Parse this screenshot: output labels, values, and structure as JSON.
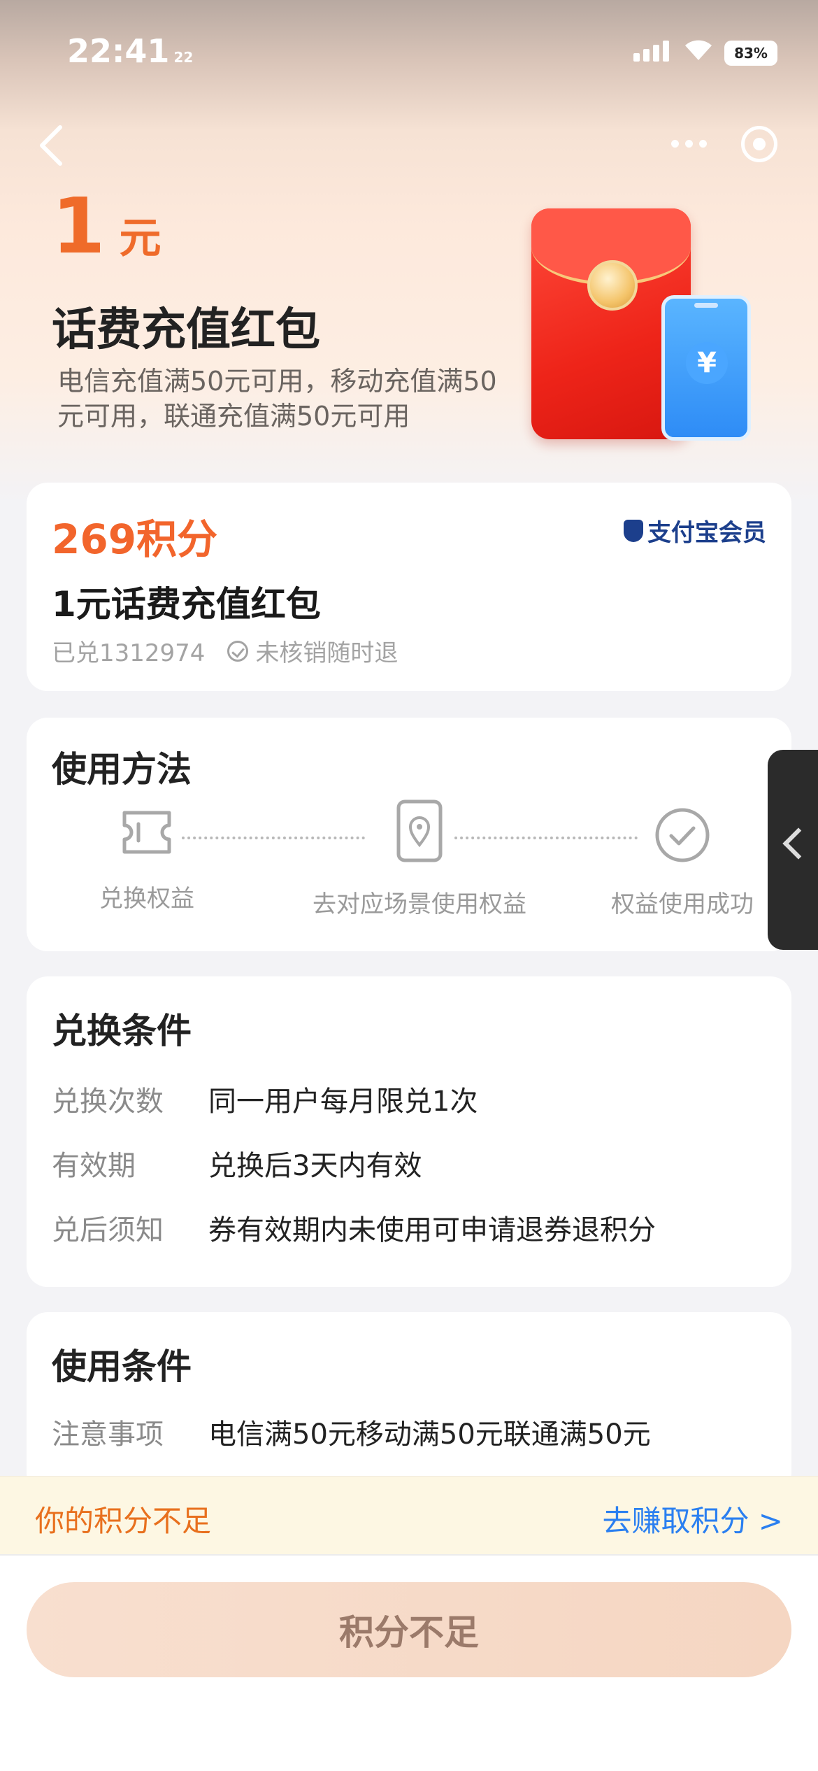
{
  "status_bar": {
    "time": "22:41",
    "time_seconds": "22",
    "battery": "83%"
  },
  "hero": {
    "amount": "1",
    "unit": "元",
    "title": "话费充值红包",
    "description": "电信充值满50元可用，移动充值满50元可用，联通充值满50元可用"
  },
  "summary": {
    "points": "269积分",
    "brand": "支付宝会员",
    "product_name": "1元话费充值红包",
    "redeemed": "已兑1312974",
    "refund_note": "未核销随时退"
  },
  "usage_method": {
    "title": "使用方法",
    "steps": [
      {
        "label": "兑换权益",
        "icon": "ticket-icon"
      },
      {
        "label": "去对应场景使用权益",
        "icon": "phone-location-icon"
      },
      {
        "label": "权益使用成功",
        "icon": "check-circle-icon"
      }
    ]
  },
  "exchange_conditions": {
    "title": "兑换条件",
    "rows": [
      {
        "key": "兑换次数",
        "value": "同一用户每月限兑1次"
      },
      {
        "key": "有效期",
        "value": "兑换后3天内有效"
      },
      {
        "key": "兑后须知",
        "value": "券有效期内未使用可申请退券退积分"
      }
    ]
  },
  "usage_conditions": {
    "title": "使用条件",
    "rows": [
      {
        "key": "注意事项",
        "value": "电信满50元移动满50元联通满50元"
      }
    ]
  },
  "notice": {
    "insufficient": "你的积分不足",
    "earn_link": "去赚取积分 >"
  },
  "footer": {
    "button_label": "积分不足"
  },
  "colors": {
    "accent_orange": "#f2652c",
    "link_blue": "#2a7ff0",
    "brand_blue": "#1c3f8c"
  }
}
